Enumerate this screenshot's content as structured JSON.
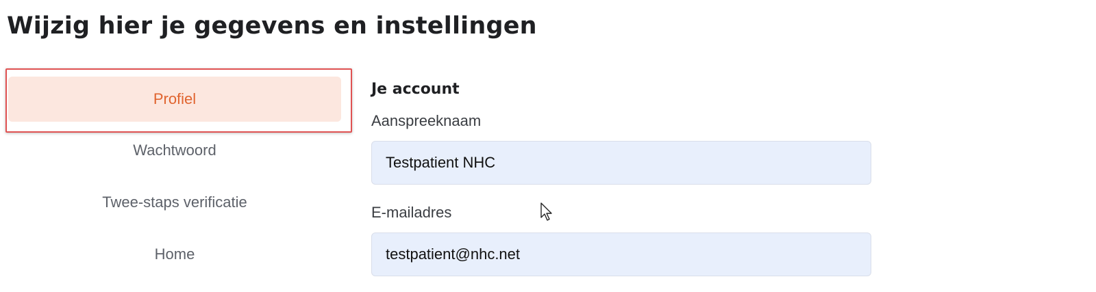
{
  "header": {
    "title": "Wijzig hier je gegevens en instellingen"
  },
  "sidebar": {
    "items": [
      {
        "label": "Profiel",
        "active": true
      },
      {
        "label": "Wachtwoord",
        "active": false
      },
      {
        "label": "Twee-staps verificatie",
        "active": false
      },
      {
        "label": "Home",
        "active": false
      }
    ]
  },
  "account": {
    "heading": "Je account",
    "fields": [
      {
        "label": "Aanspreeknaam",
        "value": "Testpatient NHC"
      },
      {
        "label": "E-mailadres",
        "value": "testpatient@nhc.net"
      }
    ]
  },
  "colors": {
    "accent": "#e0642f",
    "active_background": "#fce7df",
    "highlight_border": "#e05252",
    "input_background": "#e8effc"
  },
  "icons": {
    "cursor": "mouse-pointer-icon"
  }
}
